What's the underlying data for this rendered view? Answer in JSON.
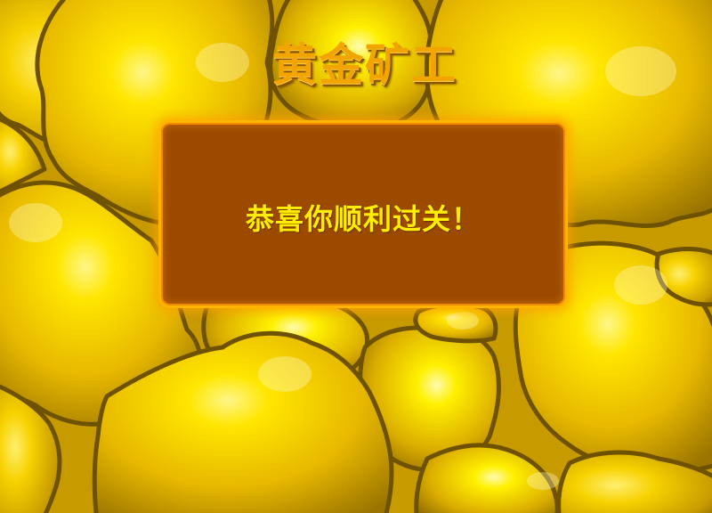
{
  "game": {
    "title": "黄金矿工",
    "background": "gold-nuggets",
    "colors": {
      "gold": "#f2c200",
      "gold_outline": "#6e5200",
      "dialog_fill": "#9b4a00",
      "dialog_glow": "#ffb400",
      "message_text": "#ffee00",
      "title_text": "#f2a400"
    }
  },
  "dialog": {
    "message": "恭喜你顺利过关！"
  }
}
